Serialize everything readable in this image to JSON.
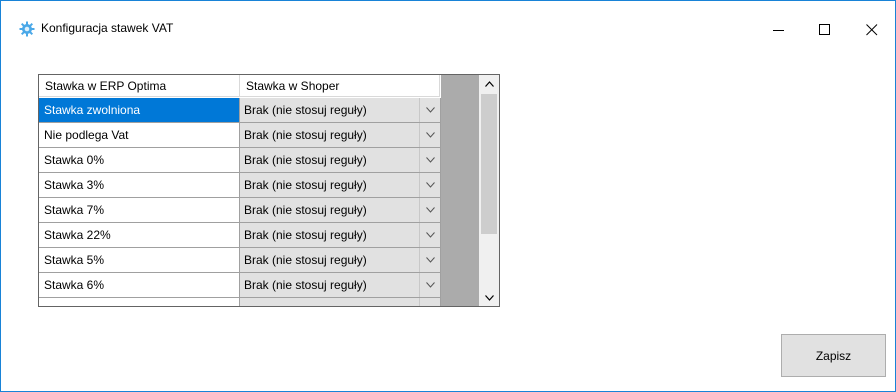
{
  "window": {
    "title": "Konfiguracja stawek VAT"
  },
  "grid": {
    "columns": [
      "Stawka w ERP Optima",
      "Stawka w Shoper"
    ],
    "rows": [
      {
        "name": "Stawka zwolniona",
        "value": "Brak (nie stosuj reguły)",
        "selected": true
      },
      {
        "name": "Nie podlega Vat",
        "value": "Brak (nie stosuj reguły)"
      },
      {
        "name": "Stawka 0%",
        "value": "Brak (nie stosuj reguły)"
      },
      {
        "name": "Stawka 3%",
        "value": "Brak (nie stosuj reguły)"
      },
      {
        "name": "Stawka 7%",
        "value": "Brak (nie stosuj reguły)"
      },
      {
        "name": "Stawka 22%",
        "value": "Brak (nie stosuj reguły)"
      },
      {
        "name": "Stawka 5%",
        "value": "Brak (nie stosuj reguły)"
      },
      {
        "name": "Stawka 6%",
        "value": "Brak (nie stosuj reguły)"
      },
      {
        "name": "",
        "value": ""
      }
    ]
  },
  "buttons": {
    "save": "Zapisz"
  },
  "colors": {
    "selection": "#0078d7",
    "window_border": "#1883d7",
    "grid_background": "#ababab",
    "combo_background": "#e1e1e1"
  },
  "icons": {
    "app": "gear-icon",
    "minimize": "minimize-icon",
    "maximize": "maximize-icon",
    "close": "close-icon",
    "combo": "chevron-down-icon"
  }
}
